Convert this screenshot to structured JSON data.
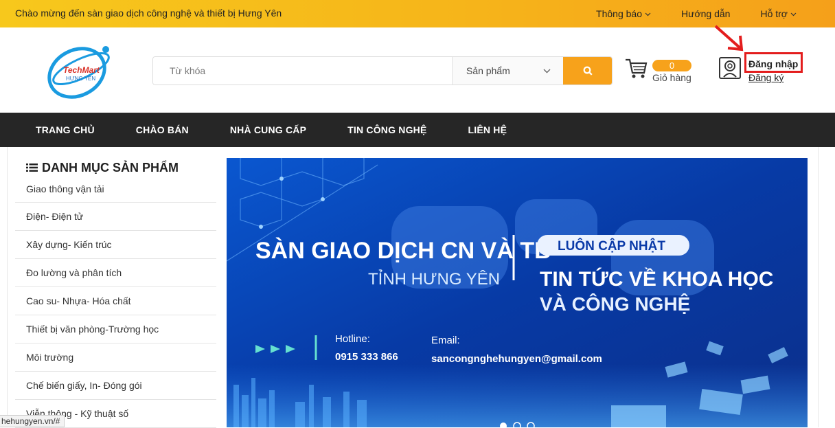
{
  "topbar": {
    "welcome": "Chào mừng đến sàn giao dịch công nghệ và thiết bị Hưng Yên",
    "links": [
      {
        "label": "Thông báo"
      },
      {
        "label": "Hướng dẫn"
      },
      {
        "label": "Hỗ trợ"
      }
    ]
  },
  "logo": {
    "line1": "TechMart",
    "line2": "HƯNG YÊN"
  },
  "search": {
    "placeholder": "Từ khóa",
    "category": "Sản phẩm"
  },
  "cart": {
    "count": "0",
    "label": "Giỏ hàng"
  },
  "account": {
    "login": "Đăng nhập",
    "register": "Đăng ký"
  },
  "mainnav": [
    "TRANG CHỦ",
    "CHÀO BÁN",
    "NHÀ CUNG CẤP",
    "TIN CÔNG NGHỆ",
    "LIÊN HỆ"
  ],
  "sidebar": {
    "title": "DANH MỤC SẢN PHẨM",
    "items": [
      "Giao thông vận tải",
      "Điện- Điện tử",
      "Xây dựng- Kiến trúc",
      "Đo lường và phân tích",
      "Cao su- Nhựa- Hóa chất",
      "Thiết bị văn phòng-Trường học",
      "Môi trường",
      "Chế biến giấy, In- Đóng gói",
      "Viễn thông - Kỹ thuật số"
    ]
  },
  "banner": {
    "title": "SÀN GIAO DỊCH CN VÀ TB",
    "subtitle": "TỈNH HƯNG YÊN",
    "pill": "LUÔN CẬP NHẬT",
    "headline1": "TIN TỨC VỀ KHOA HỌC",
    "headline2": "VÀ CÔNG NGHỆ",
    "hotline_label": "Hotline:",
    "hotline": "0915 333 866",
    "email_label": "Email:",
    "email": "sancongnghehungyen@gmail.com"
  },
  "statusbar": "hehungyen.vn/#",
  "colors": {
    "accent": "#f7a21b",
    "nav_bg": "#262626",
    "highlight": "#e31d1d",
    "banner_bg": "#0a3aa8"
  }
}
